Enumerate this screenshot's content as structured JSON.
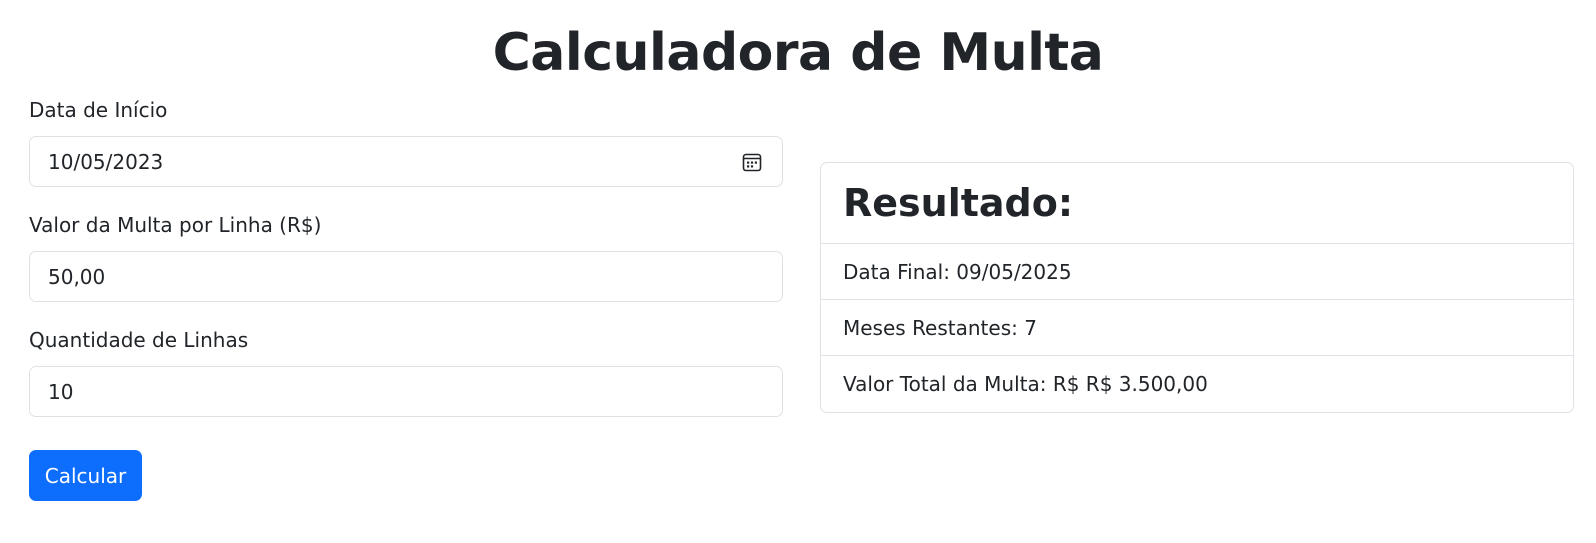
{
  "page": {
    "title": "Calculadora de Multa"
  },
  "form": {
    "start_date": {
      "label": "Data de Início",
      "value": "10/05/2023"
    },
    "fine_per_line": {
      "label": "Valor da Multa por Linha (R$)",
      "value": "50,00"
    },
    "line_quantity": {
      "label": "Quantidade de Linhas",
      "value": "10"
    },
    "calculate_label": "Calcular"
  },
  "result": {
    "title": "Resultado:",
    "items": [
      {
        "text": "Data Final: 09/05/2025"
      },
      {
        "text": "Meses Restantes: 7"
      },
      {
        "text": "Valor Total da Multa: R$ R$ 3.500,00"
      }
    ]
  },
  "colors": {
    "primary": "#0d6efd",
    "text": "#212529",
    "border": "#dee2e6"
  },
  "icons": {
    "date_picker": "calendar-icon"
  }
}
